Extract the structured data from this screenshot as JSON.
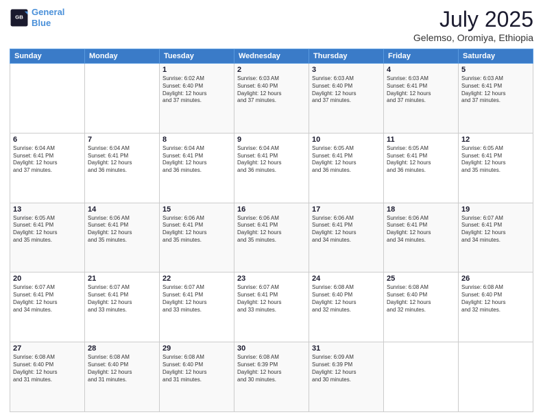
{
  "logo": {
    "line1": "General",
    "line2": "Blue"
  },
  "title": "July 2025",
  "location": "Gelemso, Oromiya, Ethiopia",
  "days_header": [
    "Sunday",
    "Monday",
    "Tuesday",
    "Wednesday",
    "Thursday",
    "Friday",
    "Saturday"
  ],
  "weeks": [
    [
      {
        "day": "",
        "text": ""
      },
      {
        "day": "",
        "text": ""
      },
      {
        "day": "1",
        "text": "Sunrise: 6:02 AM\nSunset: 6:40 PM\nDaylight: 12 hours\nand 37 minutes."
      },
      {
        "day": "2",
        "text": "Sunrise: 6:03 AM\nSunset: 6:40 PM\nDaylight: 12 hours\nand 37 minutes."
      },
      {
        "day": "3",
        "text": "Sunrise: 6:03 AM\nSunset: 6:40 PM\nDaylight: 12 hours\nand 37 minutes."
      },
      {
        "day": "4",
        "text": "Sunrise: 6:03 AM\nSunset: 6:41 PM\nDaylight: 12 hours\nand 37 minutes."
      },
      {
        "day": "5",
        "text": "Sunrise: 6:03 AM\nSunset: 6:41 PM\nDaylight: 12 hours\nand 37 minutes."
      }
    ],
    [
      {
        "day": "6",
        "text": "Sunrise: 6:04 AM\nSunset: 6:41 PM\nDaylight: 12 hours\nand 37 minutes."
      },
      {
        "day": "7",
        "text": "Sunrise: 6:04 AM\nSunset: 6:41 PM\nDaylight: 12 hours\nand 36 minutes."
      },
      {
        "day": "8",
        "text": "Sunrise: 6:04 AM\nSunset: 6:41 PM\nDaylight: 12 hours\nand 36 minutes."
      },
      {
        "day": "9",
        "text": "Sunrise: 6:04 AM\nSunset: 6:41 PM\nDaylight: 12 hours\nand 36 minutes."
      },
      {
        "day": "10",
        "text": "Sunrise: 6:05 AM\nSunset: 6:41 PM\nDaylight: 12 hours\nand 36 minutes."
      },
      {
        "day": "11",
        "text": "Sunrise: 6:05 AM\nSunset: 6:41 PM\nDaylight: 12 hours\nand 36 minutes."
      },
      {
        "day": "12",
        "text": "Sunrise: 6:05 AM\nSunset: 6:41 PM\nDaylight: 12 hours\nand 35 minutes."
      }
    ],
    [
      {
        "day": "13",
        "text": "Sunrise: 6:05 AM\nSunset: 6:41 PM\nDaylight: 12 hours\nand 35 minutes."
      },
      {
        "day": "14",
        "text": "Sunrise: 6:06 AM\nSunset: 6:41 PM\nDaylight: 12 hours\nand 35 minutes."
      },
      {
        "day": "15",
        "text": "Sunrise: 6:06 AM\nSunset: 6:41 PM\nDaylight: 12 hours\nand 35 minutes."
      },
      {
        "day": "16",
        "text": "Sunrise: 6:06 AM\nSunset: 6:41 PM\nDaylight: 12 hours\nand 35 minutes."
      },
      {
        "day": "17",
        "text": "Sunrise: 6:06 AM\nSunset: 6:41 PM\nDaylight: 12 hours\nand 34 minutes."
      },
      {
        "day": "18",
        "text": "Sunrise: 6:06 AM\nSunset: 6:41 PM\nDaylight: 12 hours\nand 34 minutes."
      },
      {
        "day": "19",
        "text": "Sunrise: 6:07 AM\nSunset: 6:41 PM\nDaylight: 12 hours\nand 34 minutes."
      }
    ],
    [
      {
        "day": "20",
        "text": "Sunrise: 6:07 AM\nSunset: 6:41 PM\nDaylight: 12 hours\nand 34 minutes."
      },
      {
        "day": "21",
        "text": "Sunrise: 6:07 AM\nSunset: 6:41 PM\nDaylight: 12 hours\nand 33 minutes."
      },
      {
        "day": "22",
        "text": "Sunrise: 6:07 AM\nSunset: 6:41 PM\nDaylight: 12 hours\nand 33 minutes."
      },
      {
        "day": "23",
        "text": "Sunrise: 6:07 AM\nSunset: 6:41 PM\nDaylight: 12 hours\nand 33 minutes."
      },
      {
        "day": "24",
        "text": "Sunrise: 6:08 AM\nSunset: 6:40 PM\nDaylight: 12 hours\nand 32 minutes."
      },
      {
        "day": "25",
        "text": "Sunrise: 6:08 AM\nSunset: 6:40 PM\nDaylight: 12 hours\nand 32 minutes."
      },
      {
        "day": "26",
        "text": "Sunrise: 6:08 AM\nSunset: 6:40 PM\nDaylight: 12 hours\nand 32 minutes."
      }
    ],
    [
      {
        "day": "27",
        "text": "Sunrise: 6:08 AM\nSunset: 6:40 PM\nDaylight: 12 hours\nand 31 minutes."
      },
      {
        "day": "28",
        "text": "Sunrise: 6:08 AM\nSunset: 6:40 PM\nDaylight: 12 hours\nand 31 minutes."
      },
      {
        "day": "29",
        "text": "Sunrise: 6:08 AM\nSunset: 6:40 PM\nDaylight: 12 hours\nand 31 minutes."
      },
      {
        "day": "30",
        "text": "Sunrise: 6:08 AM\nSunset: 6:39 PM\nDaylight: 12 hours\nand 30 minutes."
      },
      {
        "day": "31",
        "text": "Sunrise: 6:09 AM\nSunset: 6:39 PM\nDaylight: 12 hours\nand 30 minutes."
      },
      {
        "day": "",
        "text": ""
      },
      {
        "day": "",
        "text": ""
      }
    ]
  ]
}
